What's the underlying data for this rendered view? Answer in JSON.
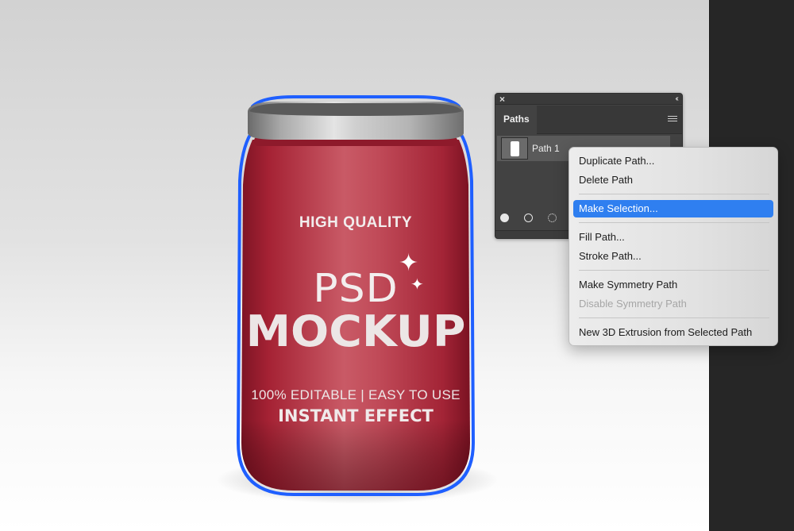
{
  "canvas": {
    "jar": {
      "headline": "HIGH QUALITY",
      "title_line1": "PSD",
      "title_line2": "MOCKUP",
      "tagline": "100% EDITABLE | EASY TO USE",
      "subtitle": "INSTANT EFFECT",
      "path_outline_color": "#1f5fff",
      "body_color": "#b02a3c",
      "lid_color": "#9a9a9a"
    }
  },
  "paths_panel": {
    "close_icon": "×",
    "collapse_icon": "‹‹",
    "tab_label": "Paths",
    "paths": [
      {
        "name": "Path 1",
        "selected": true
      }
    ],
    "footer_icons": [
      "fill-path-icon",
      "stroke-path-icon",
      "load-selection-icon"
    ]
  },
  "context_menu": {
    "items": [
      {
        "label": "Duplicate Path...",
        "enabled": true,
        "highlighted": false
      },
      {
        "label": "Delete Path",
        "enabled": true,
        "highlighted": false
      },
      {
        "label": "Make Selection...",
        "enabled": true,
        "highlighted": true
      },
      {
        "label": "Fill Path...",
        "enabled": true,
        "highlighted": false
      },
      {
        "label": "Stroke Path...",
        "enabled": true,
        "highlighted": false
      },
      {
        "label": "Make Symmetry Path",
        "enabled": true,
        "highlighted": false
      },
      {
        "label": "Disable Symmetry Path",
        "enabled": false,
        "highlighted": false
      },
      {
        "label": "New 3D Extrusion from Selected Path",
        "enabled": true,
        "highlighted": false
      }
    ],
    "highlight_color": "#2f7ff0"
  }
}
